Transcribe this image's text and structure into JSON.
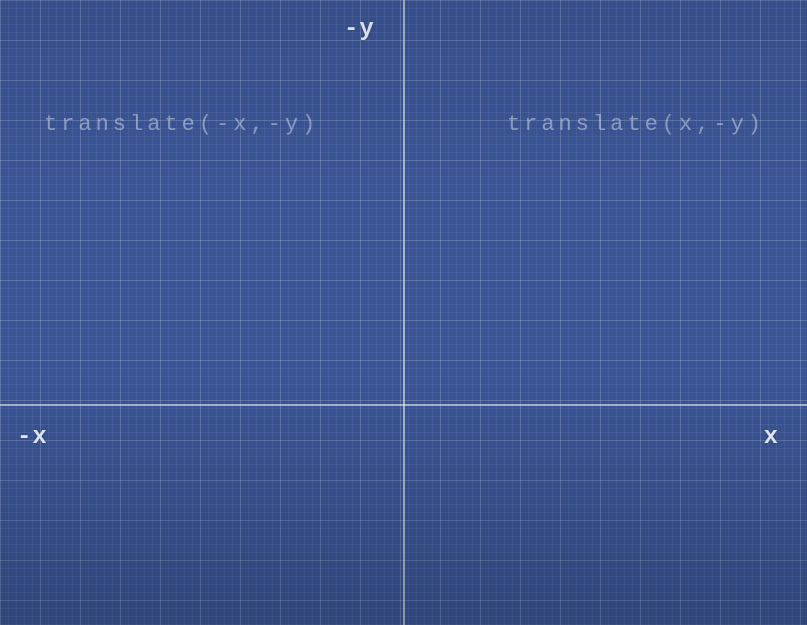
{
  "axes": {
    "neg_y_label": "-y",
    "neg_x_label": "-x",
    "pos_x_label": "x"
  },
  "quadrants": {
    "top_left_text": "translate(-x,-y)",
    "top_right_text": "translate(x,-y)"
  },
  "colors": {
    "background": "#3a5596",
    "axis": "rgba(255,255,255,0.55)"
  }
}
